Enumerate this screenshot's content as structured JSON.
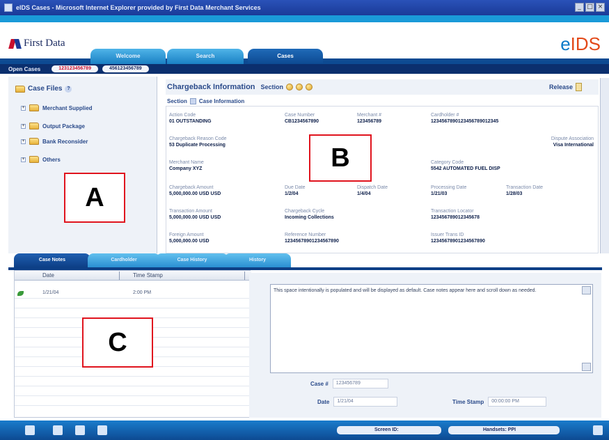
{
  "window": {
    "title": "eIDS Cases - Microsoft Internet Explorer provided by First Data Merchant Services",
    "min": "_",
    "max": "□",
    "close": "×"
  },
  "header": {
    "logo_text": "First Data",
    "brand_e": "e",
    "brand_ids": "IDS",
    "tabs": [
      "Welcome",
      "Search",
      "Cases"
    ]
  },
  "open_cases": {
    "label": "Open Cases",
    "cases": [
      "123123456789",
      "456123456789"
    ]
  },
  "case_tree": {
    "root": "Case Files",
    "help": "?",
    "items": [
      "Merchant Supplied",
      "Output Package",
      "Bank Reconsider",
      "Others"
    ]
  },
  "chargeback": {
    "title": "Chargeback Information",
    "section_label": "Section",
    "release_label": "Release",
    "case_info_label": "Case Information",
    "fields": {
      "action_code": {
        "label": "Action Code",
        "value": "01 OUTSTANDING"
      },
      "case_number": {
        "label": "Case Number",
        "value": "CB1234567890"
      },
      "merchant_no": {
        "label": "Merchant #",
        "value": "123456789"
      },
      "cardholder_no": {
        "label": "Cardholder #",
        "value": "1234567890123456789012345"
      },
      "reason_code": {
        "label": "Chargeback Reason Code",
        "value": "53 Duplicate Processing"
      },
      "dispute_association": {
        "label": "Dispute Association",
        "value": "Visa International"
      },
      "merchant_name": {
        "label": "Merchant Name",
        "value": "Company XYZ"
      },
      "category_code": {
        "label": "Category Code",
        "value": "5542 AUTOMATED FUEL DISP"
      },
      "chargeback_amount": {
        "label": "Chargeback Amount",
        "value": "5,000,000.00 USD  USD"
      },
      "due_date": {
        "label": "Due Date",
        "value": "1/2/04"
      },
      "dispatch_date": {
        "label": "Dispatch Date",
        "value": "1/4/04"
      },
      "processing_date": {
        "label": "Processing Date",
        "value": "1/21/03"
      },
      "transaction_date": {
        "label": "Transaction Date",
        "value": "1/28/03"
      },
      "transaction_amount": {
        "label": "Transaction Amount",
        "value": "5,000,000.00 USD  USD"
      },
      "chargeback_cycle": {
        "label": "Chargeback Cycle",
        "value": "Incoming Collections"
      },
      "transaction_locator": {
        "label": "Transaction Locator",
        "value": "123456789012345678"
      },
      "foreign_amount": {
        "label": "Foreign Amount",
        "value": "5,000,000.00 USD"
      },
      "reference_number": {
        "label": "Reference Number",
        "value": "12345678901234567890"
      },
      "issuer_trans_id": {
        "label": "Issuer Trans ID",
        "value": "12345678901234567890"
      }
    }
  },
  "bottom_tabs": [
    "Case Notes",
    "Cardholder",
    "Case History",
    "History"
  ],
  "notes_table": {
    "columns": [
      "Date",
      "Time Stamp"
    ],
    "rows": [
      {
        "date": "1/21/04",
        "time": "2:00 PM"
      }
    ]
  },
  "note_detail": {
    "text": "This space intentionally is populated and will be displayed as default. Case notes appear here and scroll down as needed.",
    "case_label": "Case #",
    "case_value": "123456789",
    "date_label": "Date",
    "date_value": "1/21/04",
    "time_label": "Time Stamp",
    "time_value": "00:00:00 PM"
  },
  "statusbar": {
    "screen_id_label": "Screen ID:",
    "user_label": "Handsets:",
    "user_value": "PPI"
  },
  "annotations": [
    "A",
    "B",
    "C"
  ]
}
